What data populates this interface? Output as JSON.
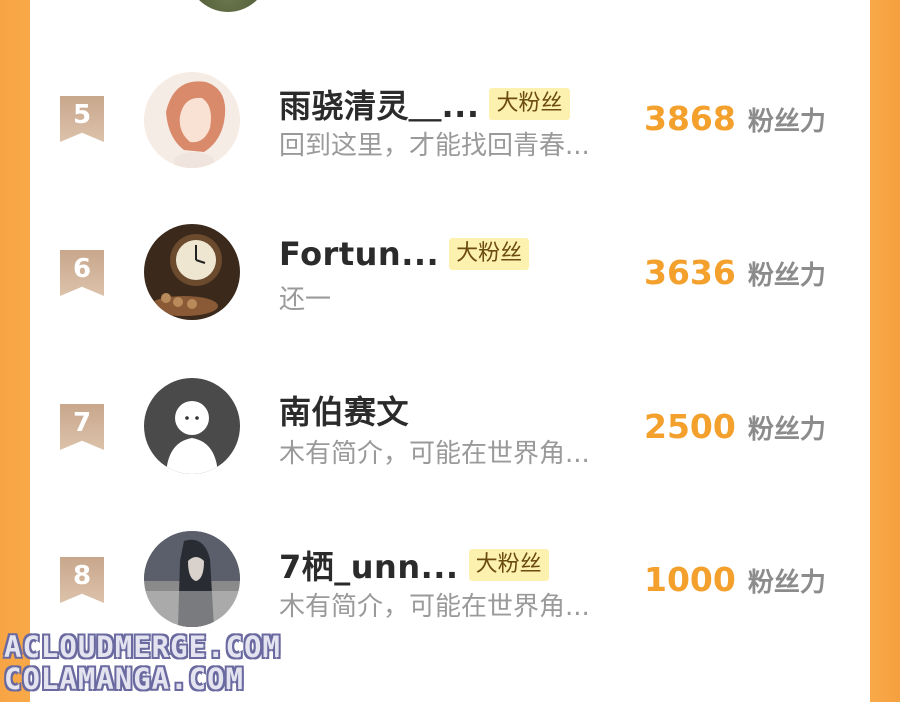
{
  "rows": [
    {
      "rank": "5",
      "name": "雨骁清灵＿...",
      "badge": "大粉丝",
      "desc": "回到这里，才能找回青春...",
      "score": "3868",
      "unit": "粉丝力"
    },
    {
      "rank": "6",
      "name": "Fortun...",
      "badge": "大粉丝",
      "desc": "还一",
      "score": "3636",
      "unit": "粉丝力"
    },
    {
      "rank": "7",
      "name": "南伯赛文",
      "badge": "",
      "desc": "木有简介，可能在世界角...",
      "score": "2500",
      "unit": "粉丝力"
    },
    {
      "rank": "8",
      "name": "7栖_unn...",
      "badge": "大粉丝",
      "desc": "木有简介，可能在世界角...",
      "score": "1000",
      "unit": "粉丝力"
    }
  ],
  "watermark": {
    "line1": "ACLOUDMERGE.COM",
    "line2": "COLAMANGA.COM"
  },
  "colors": {
    "accent": "#f3a02d",
    "badge_bg": "#fdf1b0",
    "side": "#f9a948"
  }
}
